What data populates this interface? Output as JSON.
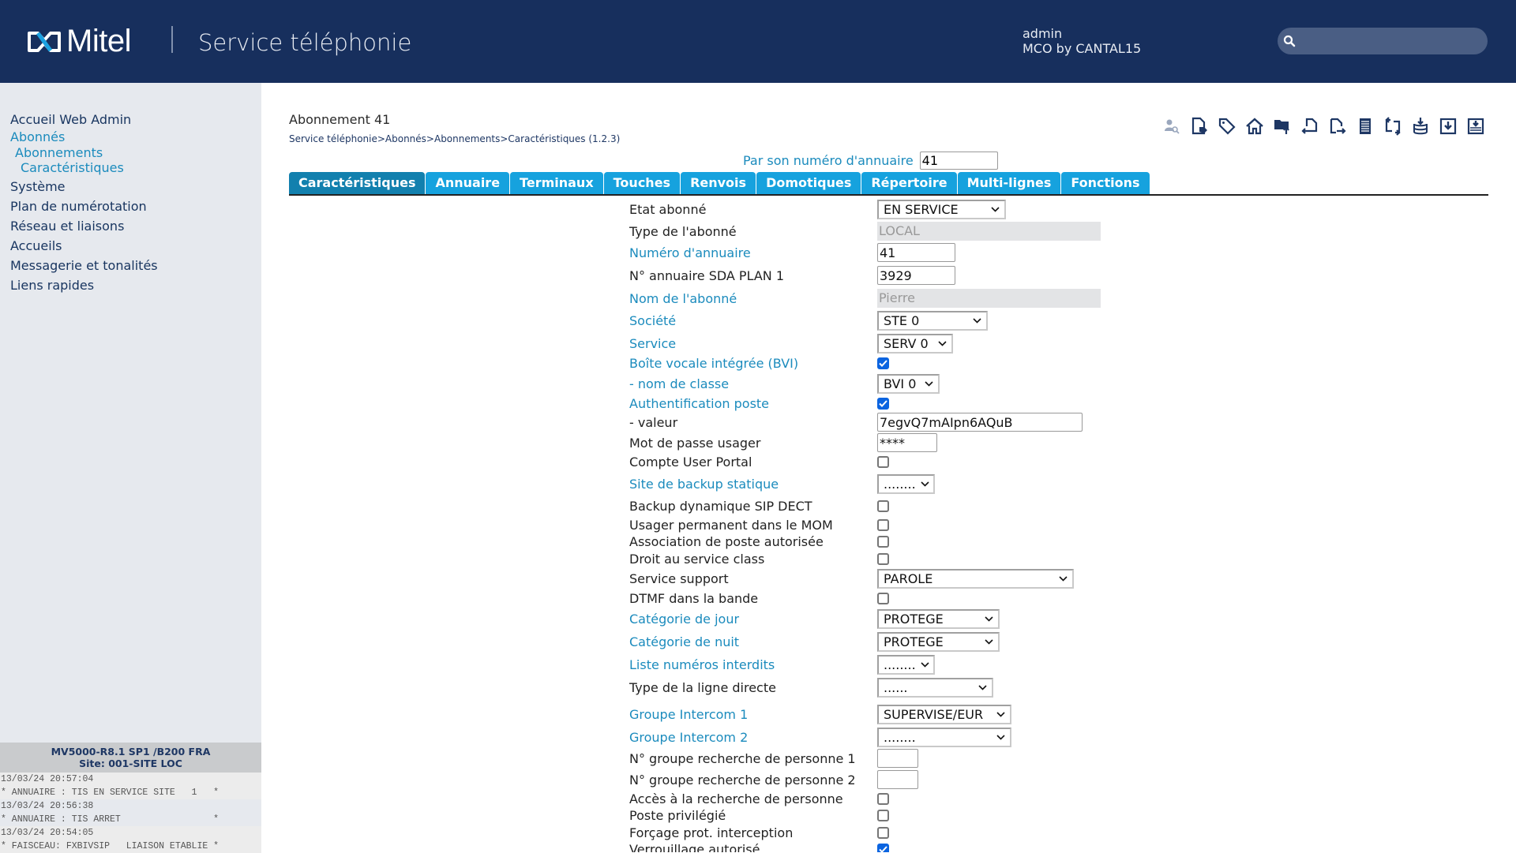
{
  "header": {
    "logo_text": "Mitel",
    "app_title": "Service téléphonie",
    "user_name": "admin",
    "user_org": "MCO by CANTAL15",
    "search_placeholder": ""
  },
  "sidebar": {
    "items": [
      {
        "label": "Accueil Web Admin",
        "level": 0
      },
      {
        "label": "Abonnés",
        "level": 0,
        "active": true
      },
      {
        "label": "Abonnements",
        "level": 1
      },
      {
        "label": "Caractéristiques",
        "level": 2
      },
      {
        "label": "Système",
        "level": 0
      },
      {
        "label": "Plan de numérotation",
        "level": 0
      },
      {
        "label": "Réseau et liaisons",
        "level": 0
      },
      {
        "label": "Accueils",
        "level": 0
      },
      {
        "label": "Messagerie et tonalités",
        "level": 0
      },
      {
        "label": "Liens rapides",
        "level": 0
      }
    ],
    "version_line1": "MV5000-R8.1 SP1 /B200 FRA",
    "version_line2": "Site: 001-SITE LOC",
    "log": [
      "13/03/24 20:57:04",
      "* ANNUAIRE : TIS EN SERVICE SITE   1   *",
      "13/03/24 20:56:38",
      "* ANNUAIRE : TIS ARRET                 *",
      "13/03/24 20:54:05",
      "* FAISCEAU: FXBIVSIP   LIAISON ETABLIE *"
    ]
  },
  "main": {
    "title": "Abonnement 41",
    "breadcrumb": "Service téléphonie>Abonnés>Abonnements>Caractéristiques (1.2.3)",
    "dir_search_label": "Par son numéro d'annuaire",
    "dir_search_value": "41",
    "toolbar_icons": [
      "user-search-icon",
      "document-tag-icon",
      "tag-icon",
      "home-icon",
      "folder-upload-icon",
      "document-back-icon",
      "document-forward-icon",
      "list-icon",
      "swap-icon",
      "database-download-icon",
      "download-box-icon",
      "save-box-icon"
    ],
    "tabs": [
      "Caractéristiques",
      "Annuaire",
      "Terminaux",
      "Touches",
      "Renvois",
      "Domotiques",
      "Répertoire",
      "Multi-lignes",
      "Fonctions"
    ],
    "active_tab": 0
  },
  "form": {
    "rows": [
      {
        "label": "Etat abonné",
        "link": false,
        "type": "select",
        "value": "EN SERVICE"
      },
      {
        "label": "Type de l'abonné",
        "link": false,
        "type": "readonly",
        "value": "LOCAL"
      },
      {
        "label": "Numéro d'annuaire",
        "link": true,
        "type": "input",
        "value": "41"
      },
      {
        "label": "N° annuaire SDA PLAN 1",
        "link": false,
        "type": "input",
        "value": "3929"
      },
      {
        "label": "Nom de l'abonné",
        "link": true,
        "type": "readonly",
        "value": "Pierre"
      },
      {
        "label": "Société",
        "link": true,
        "type": "select",
        "value": "STE 0"
      },
      {
        "label": "Service",
        "link": true,
        "type": "select",
        "value": "SERV 0"
      },
      {
        "label": "Boîte vocale intégrée (BVI)",
        "link": true,
        "type": "checkbox",
        "checked": true
      },
      {
        "label": "- nom de classe",
        "link": true,
        "type": "select",
        "value": "BVI 0"
      },
      {
        "label": "Authentification poste",
        "link": true,
        "type": "checkbox",
        "checked": true
      },
      {
        "label": "- valeur",
        "link": false,
        "type": "input",
        "value": "7egvQ7mAIpn6AQuB"
      },
      {
        "label": "Mot de passe usager",
        "link": false,
        "type": "input",
        "value": "****"
      },
      {
        "label": "Compte User Portal",
        "link": false,
        "type": "checkbox",
        "checked": false
      },
      {
        "label": "Site de backup statique",
        "link": true,
        "type": "select",
        "value": "........"
      },
      {
        "label": "Backup dynamique SIP DECT",
        "link": false,
        "type": "checkbox",
        "checked": false
      },
      {
        "label": "Usager permanent dans le MOM",
        "link": false,
        "type": "checkbox",
        "checked": false
      },
      {
        "label": "Association de poste autorisée",
        "link": false,
        "type": "checkbox",
        "checked": false
      },
      {
        "label": "Droit au service class",
        "link": false,
        "type": "checkbox",
        "checked": false
      },
      {
        "label": "Service support",
        "link": false,
        "type": "select",
        "value": "PAROLE"
      },
      {
        "label": "DTMF dans la bande",
        "link": false,
        "type": "checkbox",
        "checked": false
      },
      {
        "label": "Catégorie de jour",
        "link": true,
        "type": "select",
        "value": "PROTEGE"
      },
      {
        "label": "Catégorie de nuit",
        "link": true,
        "type": "select",
        "value": "PROTEGE"
      },
      {
        "label": "Liste numéros interdits",
        "link": true,
        "type": "select",
        "value": "........"
      },
      {
        "label": "Type de la ligne directe",
        "link": false,
        "type": "select",
        "value": "......"
      },
      {
        "label": "Groupe Intercom 1",
        "link": true,
        "type": "select",
        "value": "SUPERVISE/EUR"
      },
      {
        "label": "Groupe Intercom 2",
        "link": true,
        "type": "select",
        "value": "........"
      },
      {
        "label": "N° groupe recherche de personne 1",
        "link": false,
        "type": "input",
        "value": ""
      },
      {
        "label": "N° groupe recherche de personne 2",
        "link": false,
        "type": "input",
        "value": ""
      },
      {
        "label": "Accès à la recherche de personne",
        "link": false,
        "type": "checkbox",
        "checked": false
      },
      {
        "label": "Poste privilégié",
        "link": false,
        "type": "checkbox",
        "checked": false
      },
      {
        "label": "Forçage prot. interception",
        "link": false,
        "type": "checkbox",
        "checked": false
      },
      {
        "label": "Verrouillage autorisé",
        "link": false,
        "type": "checkbox",
        "checked": true
      }
    ]
  },
  "colors": {
    "header_bg": "#172f5d",
    "accent": "#16a2de",
    "active_tab": "#1280ae",
    "link": "#1b8bbd",
    "nav_text": "#17345f",
    "checkbox_checked": "#0b64e0"
  }
}
